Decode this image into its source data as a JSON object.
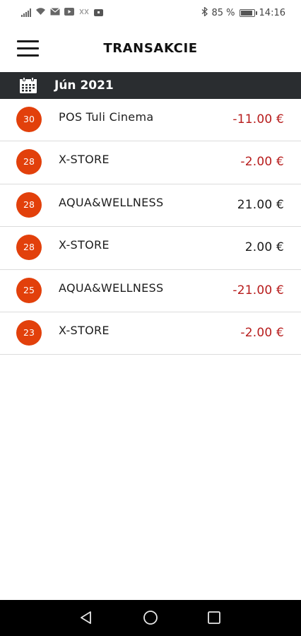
{
  "status_bar": {
    "battery_percent": "85 %",
    "time": "14:16",
    "icons": [
      "signal-icon",
      "wifi-icon",
      "mail-icon",
      "youtube-icon",
      "notification-icon",
      "app-icon",
      "bluetooth-icon",
      "battery-icon"
    ]
  },
  "header": {
    "title": "TRANSAKCIE",
    "menu_icon": "hamburger-menu-icon"
  },
  "month_section": {
    "label": "Jún 2021",
    "icon": "calendar-icon",
    "background": "#2a2d30"
  },
  "colors": {
    "badge": "#e2400b",
    "negative_amount": "#b71c1c",
    "positive_amount": "#1b1b1b"
  },
  "transactions": [
    {
      "day": "30",
      "merchant": "POS Tuli Cinema",
      "amount": "-11.00 €",
      "type": "negative"
    },
    {
      "day": "28",
      "merchant": "X-STORE",
      "amount": "-2.00 €",
      "type": "negative"
    },
    {
      "day": "28",
      "merchant": "AQUA&WELLNESS",
      "amount": "21.00 €",
      "type": "positive"
    },
    {
      "day": "28",
      "merchant": "X-STORE",
      "amount": "2.00 €",
      "type": "positive"
    },
    {
      "day": "25",
      "merchant": "AQUA&WELLNESS",
      "amount": "-21.00 €",
      "type": "negative"
    },
    {
      "day": "23",
      "merchant": "X-STORE",
      "amount": "-2.00 €",
      "type": "negative"
    }
  ],
  "nav_bar": {
    "buttons": [
      "back-icon",
      "home-icon",
      "recent-apps-icon"
    ]
  }
}
